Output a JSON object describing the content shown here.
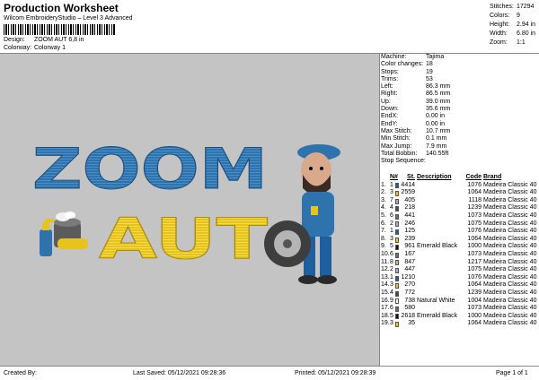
{
  "header": {
    "title": "Production Worksheet",
    "subtitle": "Wilcom EmbroideryStudio – Level 3 Advanced",
    "design_label": "Design:",
    "design_value": "ZOOM AUT 6,8 in",
    "colorway_label": "Colorway:",
    "colorway_value": "Colorway 1"
  },
  "stats": [
    {
      "k": "Stitches:",
      "v": "17294"
    },
    {
      "k": "Colors:",
      "v": "9"
    },
    {
      "k": "Height:",
      "v": "2.94 in"
    },
    {
      "k": "Width:",
      "v": "6.80 in"
    },
    {
      "k": "Zoom:",
      "v": "1:1"
    }
  ],
  "artwork": {
    "line1": "ZOOM",
    "line2": "AUT"
  },
  "info": [
    {
      "k": "Machine:",
      "v": "Tajima"
    },
    {
      "k": "Color changes:",
      "v": "18"
    },
    {
      "k": "Stops:",
      "v": "19"
    },
    {
      "k": "Trims:",
      "v": "53"
    },
    {
      "k": "Left:",
      "v": "86.3 mm"
    },
    {
      "k": "Right:",
      "v": "86.5 mm"
    },
    {
      "k": "Up:",
      "v": "39.0 mm"
    },
    {
      "k": "Down:",
      "v": "35.6 mm"
    },
    {
      "k": "EndX:",
      "v": "0.00 in"
    },
    {
      "k": "EndY:",
      "v": "0.00 in"
    },
    {
      "k": "Max Stitch:",
      "v": "10.7 mm"
    },
    {
      "k": "Min Stitch:",
      "v": "0.1 mm"
    },
    {
      "k": "Max Jump:",
      "v": "7.9 mm"
    },
    {
      "k": "Total Bobbin:",
      "v": "140.55ft"
    }
  ],
  "sequence": {
    "title": "Stop Sequence:",
    "headers": [
      "",
      "N#",
      "St.",
      "Description",
      "Code",
      "Brand"
    ],
    "rows": [
      {
        "stop": "1.",
        "n": "1",
        "color": "#1f5f9e",
        "st": "4414",
        "desc": "",
        "code": "1076",
        "brand": "Madeira Classic 40"
      },
      {
        "stop": "2.",
        "n": "3",
        "color": "#f2c21a",
        "st": "2559",
        "desc": "",
        "code": "1064",
        "brand": "Madeira Classic 40"
      },
      {
        "stop": "3.",
        "n": "7",
        "color": "#a8a8a8",
        "st": "405",
        "desc": "",
        "code": "1118",
        "brand": "Madeira Classic 40"
      },
      {
        "stop": "4.",
        "n": "4",
        "color": "#4a4a4a",
        "st": "218",
        "desc": "",
        "code": "1239",
        "brand": "Madeira Classic 40"
      },
      {
        "stop": "5.",
        "n": "6",
        "color": "#6e6e6e",
        "st": "441",
        "desc": "",
        "code": "1073",
        "brand": "Madeira Classic 40"
      },
      {
        "stop": "6.",
        "n": "2",
        "color": "#8fb6d8",
        "st": "246",
        "desc": "",
        "code": "1075",
        "brand": "Madeira Classic 40"
      },
      {
        "stop": "7.",
        "n": "1",
        "color": "#1f5f9e",
        "st": "125",
        "desc": "",
        "code": "1076",
        "brand": "Madeira Classic 40"
      },
      {
        "stop": "8.",
        "n": "3",
        "color": "#f2c21a",
        "st": "239",
        "desc": "",
        "code": "1064",
        "brand": "Madeira Classic 40"
      },
      {
        "stop": "9.",
        "n": "5",
        "color": "#111111",
        "st": "961",
        "desc": "Emerald Black",
        "code": "1000",
        "brand": "Madeira Classic 40"
      },
      {
        "stop": "10.",
        "n": "6",
        "color": "#6e6e6e",
        "st": "167",
        "desc": "",
        "code": "1073",
        "brand": "Madeira Classic 40"
      },
      {
        "stop": "11.",
        "n": "8",
        "color": "#d9a98b",
        "st": "847",
        "desc": "",
        "code": "1217",
        "brand": "Madeira Classic 40"
      },
      {
        "stop": "12.",
        "n": "2",
        "color": "#8fb6d8",
        "st": "447",
        "desc": "",
        "code": "1075",
        "brand": "Madeira Classic 40"
      },
      {
        "stop": "13.",
        "n": "1",
        "color": "#1f5f9e",
        "st": "1210",
        "desc": "",
        "code": "1076",
        "brand": "Madeira Classic 40"
      },
      {
        "stop": "14.",
        "n": "3",
        "color": "#f2c21a",
        "st": "270",
        "desc": "",
        "code": "1064",
        "brand": "Madeira Classic 40"
      },
      {
        "stop": "15.",
        "n": "4",
        "color": "#4a4a4a",
        "st": "772",
        "desc": "",
        "code": "1239",
        "brand": "Madeira Classic 40"
      },
      {
        "stop": "16.",
        "n": "9",
        "color": "#f4f4f4",
        "st": "738",
        "desc": "Natural White",
        "code": "1004",
        "brand": "Madeira Classic 40"
      },
      {
        "stop": "17.",
        "n": "6",
        "color": "#6e6e6e",
        "st": "580",
        "desc": "",
        "code": "1073",
        "brand": "Madeira Classic 40"
      },
      {
        "stop": "18.",
        "n": "5",
        "color": "#111111",
        "st": "2618",
        "desc": "Emerald Black",
        "code": "1000",
        "brand": "Madeira Classic 40"
      },
      {
        "stop": "19.",
        "n": "3",
        "color": "#f2c21a",
        "st": "35",
        "desc": "",
        "code": "1064",
        "brand": "Madeira Classic 40"
      }
    ]
  },
  "footer": {
    "created_by": "Created By:",
    "last_saved": "Last Saved: 05/12/2021 09:28:36",
    "printed": "Printed: 05/12/2021 09:28:39",
    "page": "Page 1 of 1"
  }
}
